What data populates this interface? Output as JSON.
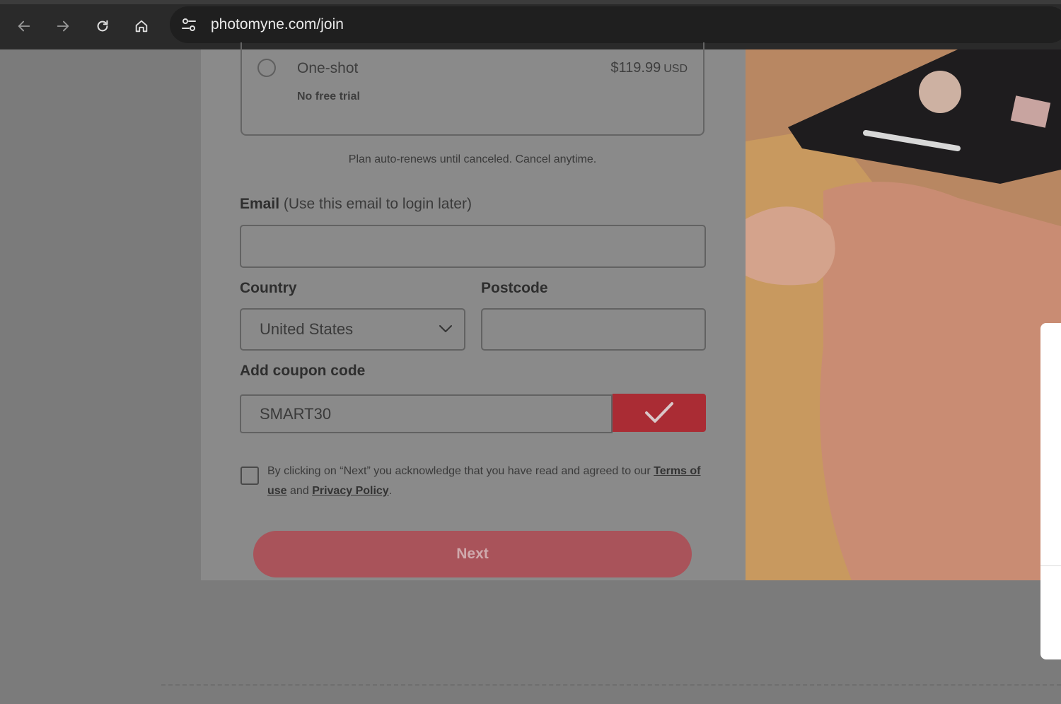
{
  "browser": {
    "url": "photomyne.com/join"
  },
  "plan": {
    "name": "One-shot",
    "price": "$119.99",
    "currency": "USD",
    "subtitle": "No free trial"
  },
  "renew_note": "Plan auto-renews until canceled. Cancel anytime.",
  "email": {
    "label": "Email",
    "hint": "(Use this email to login later)",
    "value": ""
  },
  "country": {
    "label": "Country",
    "selected": "United States"
  },
  "postcode": {
    "label": "Postcode",
    "value": ""
  },
  "coupon": {
    "label": "Add coupon code",
    "value": "SMART30"
  },
  "terms": {
    "prefix": "By clicking on “Next” you acknowledge that you have read and agreed to our",
    "terms_link": "Terms of use",
    "and": "and",
    "privacy_link": "Privacy Policy",
    "suffix": "."
  },
  "next_button": "Next",
  "colors": {
    "accent": "#aa2c34",
    "next_button": "#a9535a"
  }
}
